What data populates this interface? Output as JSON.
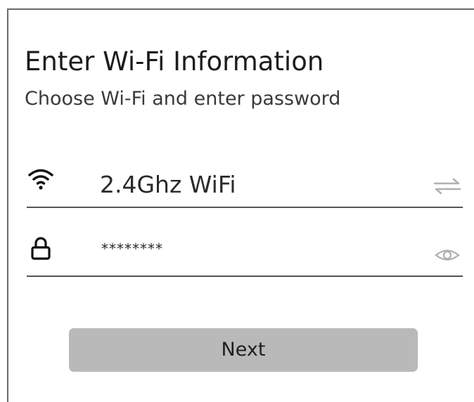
{
  "header": {
    "title": "Enter Wi-Fi Information",
    "subtitle": "Choose Wi-Fi and enter password"
  },
  "wifi_field": {
    "icon": "wifi-icon",
    "value": "2.4Ghz WiFi",
    "action_icon": "swap-arrows-icon"
  },
  "password_field": {
    "icon": "lock-icon",
    "value": "********",
    "action_icon": "eye-icon"
  },
  "next_button": {
    "label": "Next"
  },
  "colors": {
    "button_bg": "#b9b9b9",
    "divider": "#555555",
    "text": "#1f1f1f",
    "muted_icon": "#b0b0b0"
  }
}
